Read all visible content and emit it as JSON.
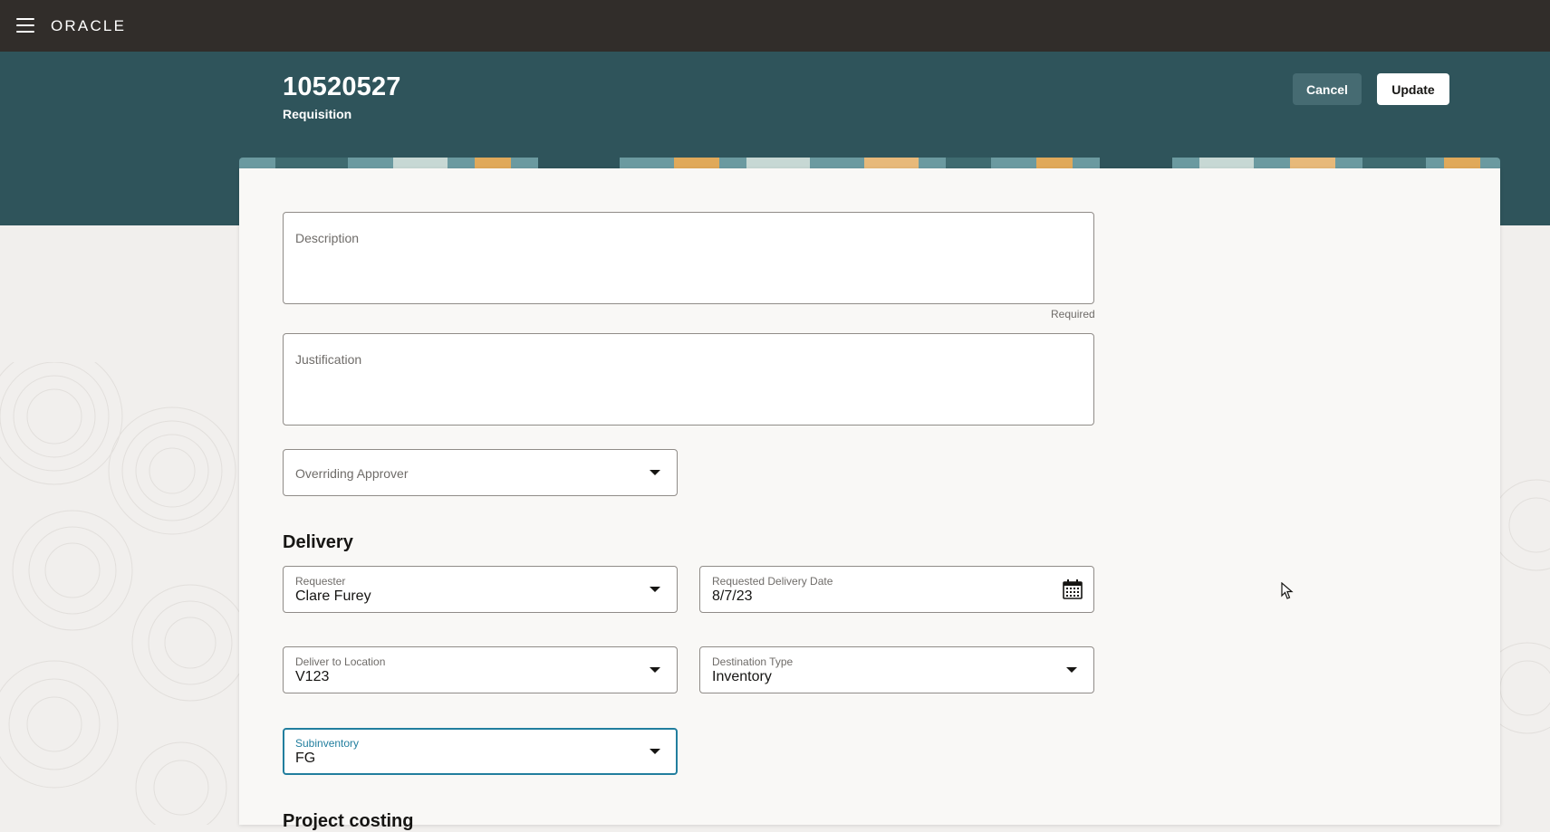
{
  "topbar": {
    "menu_icon": "hamburger-menu-icon",
    "brand": "ORACLE"
  },
  "header": {
    "requisition_number": "10520527",
    "subtitle": "Requisition",
    "cancel_label": "Cancel",
    "update_label": "Update"
  },
  "form": {
    "description": {
      "placeholder": "Description",
      "helper": "Required"
    },
    "justification": {
      "placeholder": "Justification"
    },
    "overriding_approver": {
      "placeholder": "Overriding Approver",
      "icon": "chevron-down-icon"
    }
  },
  "delivery": {
    "title": "Delivery",
    "requester": {
      "label": "Requester",
      "value": "Clare Furey"
    },
    "requested_delivery_date": {
      "label": "Requested Delivery Date",
      "value": "8/7/23",
      "icon": "calendar-icon"
    },
    "deliver_to_location": {
      "label": "Deliver to Location",
      "value": "V123"
    },
    "destination_type": {
      "label": "Destination Type",
      "value": "Inventory"
    },
    "subinventory": {
      "label": "Subinventory",
      "value": "FG"
    }
  },
  "project_costing": {
    "title": "Project costing"
  },
  "colors": {
    "topbar": "#312d2a",
    "header": "#2f545b",
    "focus": "#227e9e",
    "card": "#f9f8f6"
  }
}
